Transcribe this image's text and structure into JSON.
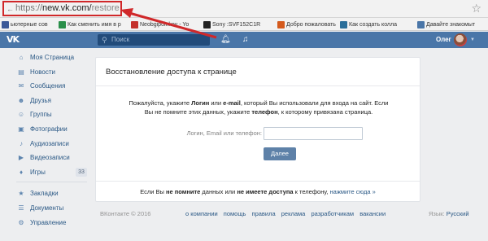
{
  "browser": {
    "url_protocol": "https://",
    "url_host": "new.vk.com/",
    "url_path": "restore",
    "bookmarks": [
      {
        "label": "ьютерные сов",
        "color": "#3b5998"
      },
      {
        "label": "Как сменить имя в р",
        "color": "#2a8f4a"
      },
      {
        "label": "Neоbgipolnkov - Yo",
        "color": "#c4302b"
      },
      {
        "label": "Sony :SVF152C1R",
        "color": "#222222"
      },
      {
        "label": "Добро пожаловать",
        "color": "#d45a1d"
      },
      {
        "label": "Как создать колла",
        "color": "#2a6e9a"
      },
      {
        "label": "Давайте знакомыт",
        "color": "#4a76a8"
      }
    ]
  },
  "header": {
    "logo": "VK",
    "search_placeholder": "Поиск",
    "user_name": "Олег"
  },
  "sidebar": {
    "items": [
      {
        "label": "Моя Страница",
        "icon": "home-icon"
      },
      {
        "label": "Новости",
        "icon": "news-icon"
      },
      {
        "label": "Сообщения",
        "icon": "message-icon"
      },
      {
        "label": "Друзья",
        "icon": "friends-icon"
      },
      {
        "label": "Группы",
        "icon": "groups-icon"
      },
      {
        "label": "Фотографии",
        "icon": "photo-icon"
      },
      {
        "label": "Аудиозаписи",
        "icon": "audio-icon"
      },
      {
        "label": "Видеозаписи",
        "icon": "video-icon"
      },
      {
        "label": "Игры",
        "icon": "games-icon",
        "count": "33"
      }
    ],
    "extra": [
      {
        "label": "Закладки",
        "icon": "bookmarks-icon"
      },
      {
        "label": "Документы",
        "icon": "documents-icon"
      },
      {
        "label": "Управление",
        "icon": "manage-icon"
      }
    ]
  },
  "restore": {
    "title": "Восстановление доступа к странице",
    "info_1": "Пожалуйста, укажите ",
    "info_login": "Логин",
    "info_2": " или ",
    "info_email": "e-mail",
    "info_3": ", который Вы использовали для входа на сайт. Если",
    "info_4": "Вы не помните этих данных, укажите ",
    "info_phone": "телефон",
    "info_5": ", к которому привязана страница.",
    "field_label": "Логин, Email или телефон:",
    "field_value": "",
    "next_button": "Далее",
    "foot_1": "Если Вы ",
    "foot_dont_remember": "не помните",
    "foot_2": " данных или ",
    "foot_no_access": "не имеете доступа",
    "foot_3": " к телефону, ",
    "foot_link": "нажмите сюда »"
  },
  "footer": {
    "copyright": "ВКонтакте © 2016",
    "links": [
      "о компании",
      "помощь",
      "правила",
      "реклама",
      "разработчикам",
      "вакансии"
    ],
    "lang_label": "Язык:",
    "lang_value": "Русский"
  },
  "colors": {
    "brand": "#4a76a8",
    "annotation": "#d0282a"
  }
}
